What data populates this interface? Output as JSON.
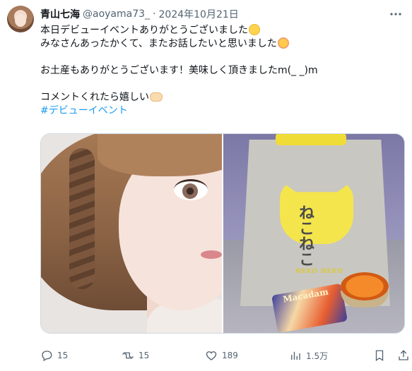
{
  "tweet": {
    "author_name": "青山七海",
    "handle": "@aoyama73_",
    "separator": "·",
    "date": "2024年10月21日",
    "lines": [
      "本日デビューイベントありがとうございました",
      "みなさんあったかくて、またお話したいと思いました",
      "",
      "お土産もありがとうございます！美味しく頂きましたm(_ _)m",
      "",
      "コメントくれたら嬉しい"
    ],
    "hashtag": "#デビューイベント"
  },
  "media": {
    "bag_brand": "NEKO NEKO",
    "bag_logo_text": "ねこねこ",
    "snack_label": "Macadam"
  },
  "actions": {
    "replies": "15",
    "retweets": "15",
    "likes": "189",
    "views": "1.5万"
  },
  "icons": {
    "more": "more-dots-icon",
    "reply": "reply-icon",
    "retweet": "retweet-icon",
    "like": "heart-icon",
    "views": "views-icon",
    "bookmark": "bookmark-icon",
    "share": "share-icon"
  },
  "colors": {
    "text": "#0f1419",
    "muted": "#536471",
    "link": "#1d9bf0",
    "border": "#cfd9de"
  }
}
